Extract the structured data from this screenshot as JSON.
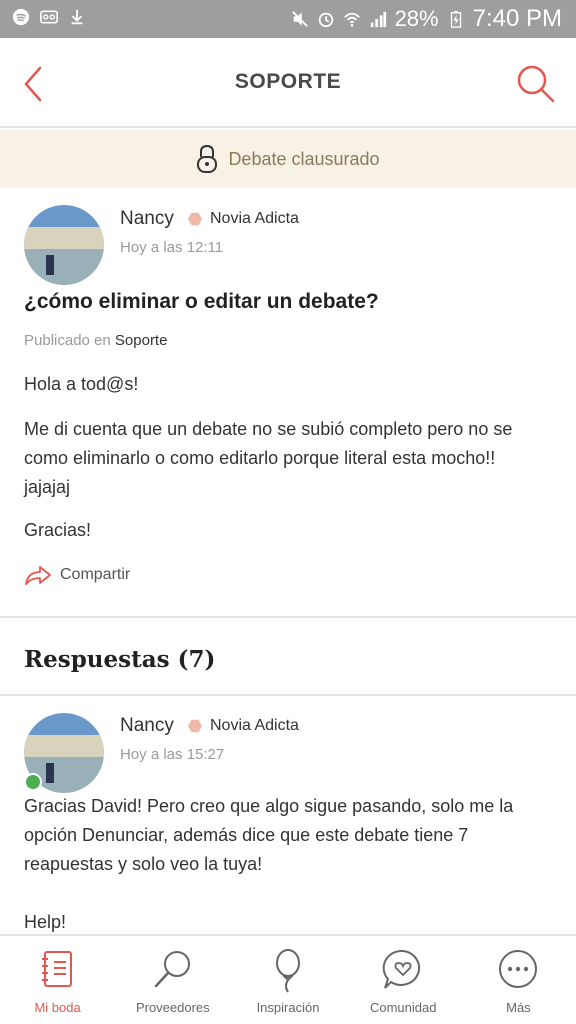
{
  "status_bar": {
    "battery": "28%",
    "time": "7:40 PM"
  },
  "header": {
    "title": "SOPORTE"
  },
  "banner": {
    "text": "Debate clausurado"
  },
  "post": {
    "author": "Nancy",
    "badge": "Novia Adicta",
    "timestamp": "Hoy a las 12:11",
    "title": "¿cómo eliminar o editar un debate?",
    "published_prefix": "Publicado en",
    "category": "Soporte",
    "paragraphs": [
      "Hola a tod@s!",
      "Me di cuenta que un debate no se subió completo pero no se como eliminarlo o como editarlo porque literal esta mocho!! jajajaj",
      "Gracias!"
    ],
    "share_label": "Compartir"
  },
  "answers": {
    "title": "Respuestas (7)",
    "items": [
      {
        "author": "Nancy",
        "badge": "Novia Adicta",
        "timestamp": "Hoy a las 15:27",
        "paragraphs": [
          "Gracias David! Pero creo que algo sigue pasando, solo me la opción Denunciar, además dice que este debate tiene 7 reapuestas y solo veo la tuya!",
          "Help!"
        ]
      }
    ]
  },
  "bottom_nav": {
    "items": [
      {
        "label": "Mi boda",
        "icon": "notebook-icon",
        "active": true
      },
      {
        "label": "Proveedores",
        "icon": "search-icon",
        "active": false
      },
      {
        "label": "Inspiración",
        "icon": "balloon-icon",
        "active": false
      },
      {
        "label": "Comunidad",
        "icon": "chat-heart-icon",
        "active": false
      },
      {
        "label": "Más",
        "icon": "more-icon",
        "active": false
      }
    ]
  },
  "colors": {
    "accent": "#e4574f",
    "banner_bg": "#f8f1e6",
    "online": "#4caf50"
  }
}
